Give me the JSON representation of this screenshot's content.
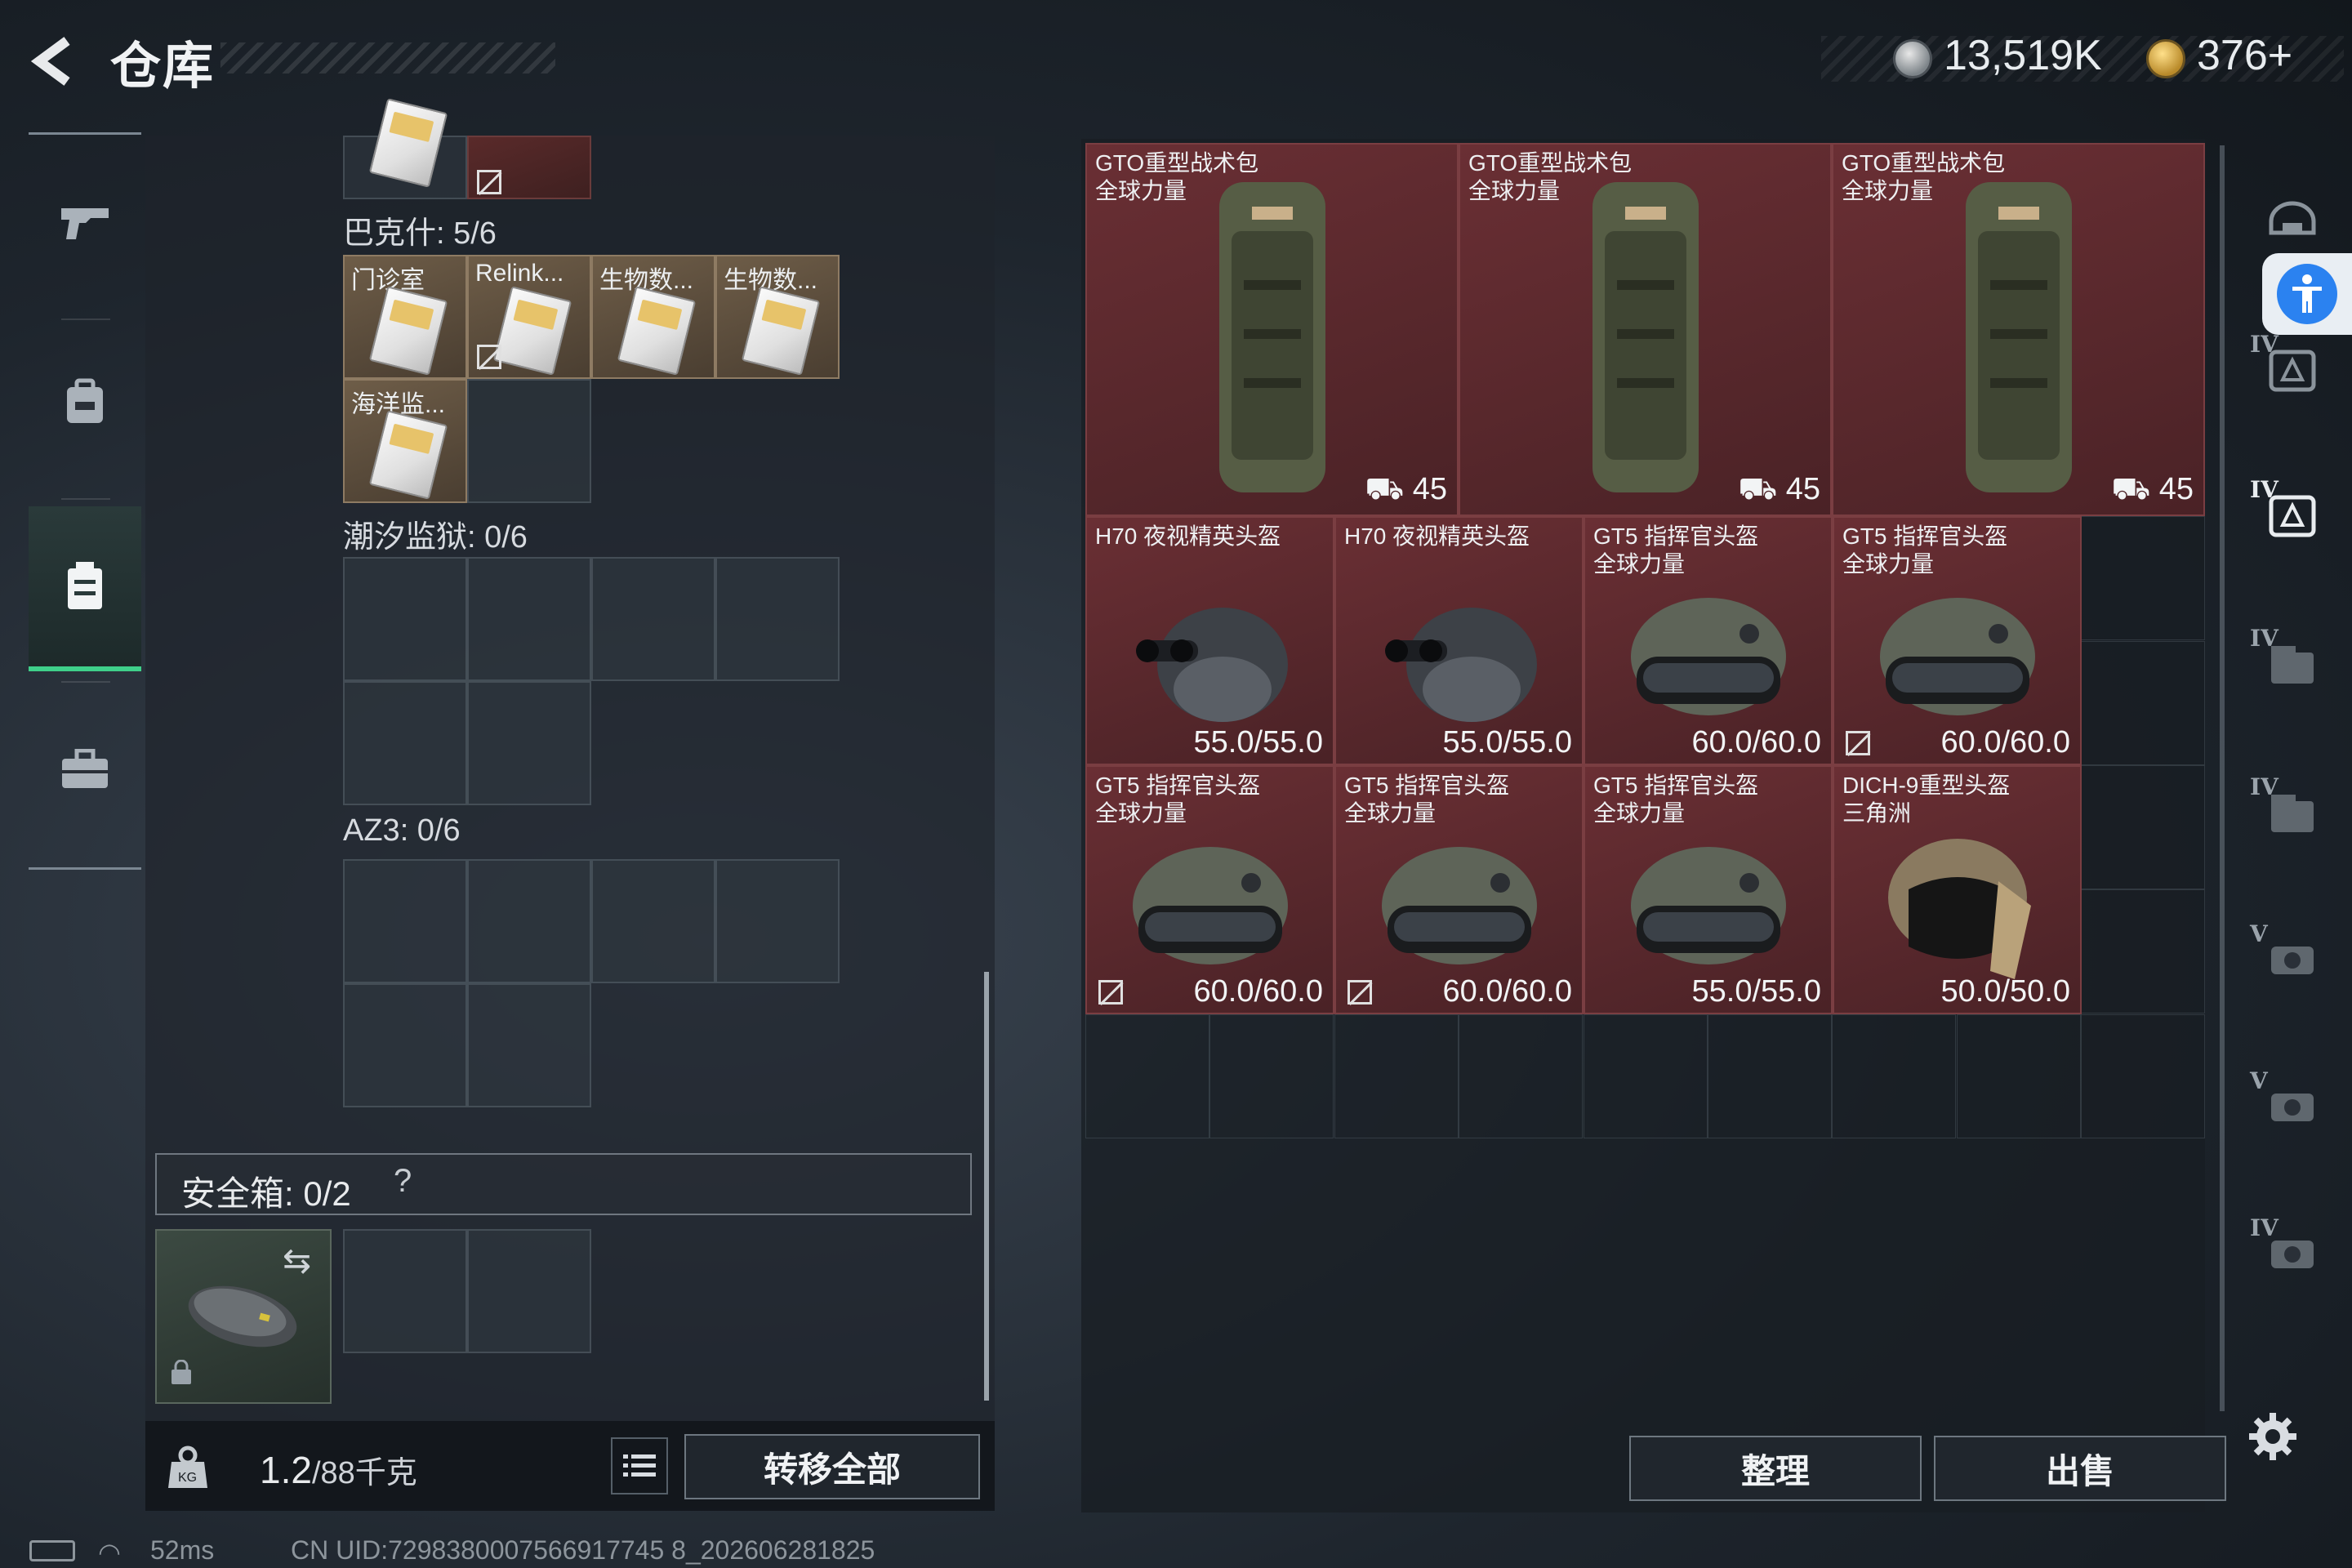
{
  "header": {
    "title": "仓库",
    "currency_1": "13,519K",
    "currency_2": "376+"
  },
  "left_nav": {
    "items": [
      {
        "name": "weapon",
        "icon": "gun-icon"
      },
      {
        "name": "equipment",
        "icon": "backpack-icon"
      },
      {
        "name": "storage",
        "icon": "container-icon",
        "active": true
      },
      {
        "name": "case",
        "icon": "briefcase-icon"
      }
    ]
  },
  "center": {
    "sections": [
      {
        "title": "巴克什: 5/6",
        "cells": [
          "门诊室",
          "Relink...",
          "生物数...",
          "生物数...",
          "海洋监..."
        ]
      },
      {
        "title": "潮汐监狱: 0/6"
      },
      {
        "title": "AZ3: 0/6"
      }
    ],
    "safebox_label": "安全箱: 0/2",
    "safebox_help": "?",
    "weight": "1.2",
    "weight_max": "/88千克",
    "transfer_all": "转移全部"
  },
  "right": {
    "items": [
      {
        "name_line1": "GTO重型战术包",
        "name_line2": "全球力量",
        "value": "45"
      },
      {
        "name_line1": "GTO重型战术包",
        "name_line2": "全球力量",
        "value": "45"
      },
      {
        "name_line1": "GTO重型战术包",
        "name_line2": "全球力量",
        "value": "45"
      },
      {
        "name_line1": "H70 夜视精英头盔",
        "name_line2": "",
        "value": "55.0/55.0"
      },
      {
        "name_line1": "H70 夜视精英头盔",
        "name_line2": "",
        "value": "55.0/55.0"
      },
      {
        "name_line1": "GT5 指挥官头盔",
        "name_line2": "全球力量",
        "value": "60.0/60.0"
      },
      {
        "name_line1": "GT5 指挥官头盔",
        "name_line2": "全球力量",
        "value": "60.0/60.0"
      },
      {
        "name_line1": "GT5 指挥官头盔",
        "name_line2": "全球力量",
        "value": "60.0/60.0"
      },
      {
        "name_line1": "GT5 指挥官头盔",
        "name_line2": "全球力量",
        "value": "60.0/60.0"
      },
      {
        "name_line1": "GT5 指挥官头盔",
        "name_line2": "全球力量",
        "value": "55.0/55.0"
      },
      {
        "name_line1": "DICH-9重型头盔",
        "name_line2": "三角洲",
        "value": "50.0/50.0"
      }
    ],
    "sort_label": "整理",
    "sell_label": "出售"
  },
  "right_rail": {
    "tabs": [
      {
        "tier": "",
        "icon": "helmet-icon"
      },
      {
        "tier": "IV",
        "icon": "armor-icon"
      },
      {
        "tier": "IV",
        "icon": "armor-icon"
      },
      {
        "tier": "IV",
        "icon": "case-icon"
      },
      {
        "tier": "IV",
        "icon": "case-icon"
      },
      {
        "tier": "V",
        "icon": "gear-case-icon"
      },
      {
        "tier": "V",
        "icon": "gear-case-icon"
      },
      {
        "tier": "IV",
        "icon": "gear-case-icon"
      }
    ]
  },
  "status": {
    "ping": "52ms",
    "uid": "CN UID:7298380007566917745 8_202606281825"
  },
  "colors": {
    "accent_green": "#3fd08a",
    "item_red": "#5a2a2e",
    "item_gold": "#6e5d48",
    "accessibility_blue": "#2b82f0"
  }
}
